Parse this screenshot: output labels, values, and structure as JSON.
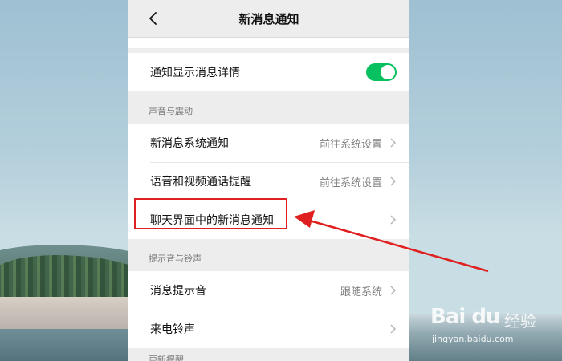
{
  "header": {
    "title": "新消息通知"
  },
  "notify_detail": {
    "label": "通知显示消息详情",
    "toggle_on": true
  },
  "sound_section": {
    "title": "声音与震动",
    "items": [
      {
        "label": "新消息系统通知",
        "value": "前往系统设置"
      },
      {
        "label": "语音和视频通话提醒",
        "value": "前往系统设置"
      },
      {
        "label": "聊天界面中的新消息通知",
        "value": ""
      }
    ]
  },
  "tone_section": {
    "title": "提示音与铃声",
    "items": [
      {
        "label": "消息提示音",
        "value": "跟随系统"
      },
      {
        "label": "来电铃声",
        "value": ""
      }
    ]
  },
  "next_section": {
    "title": "更新提醒"
  },
  "colors": {
    "toggle": "#07c160",
    "annotation": "#e02020"
  },
  "watermark": {
    "logo": "Bai du",
    "text": "经验",
    "url": "jingyan.baidu.com"
  }
}
